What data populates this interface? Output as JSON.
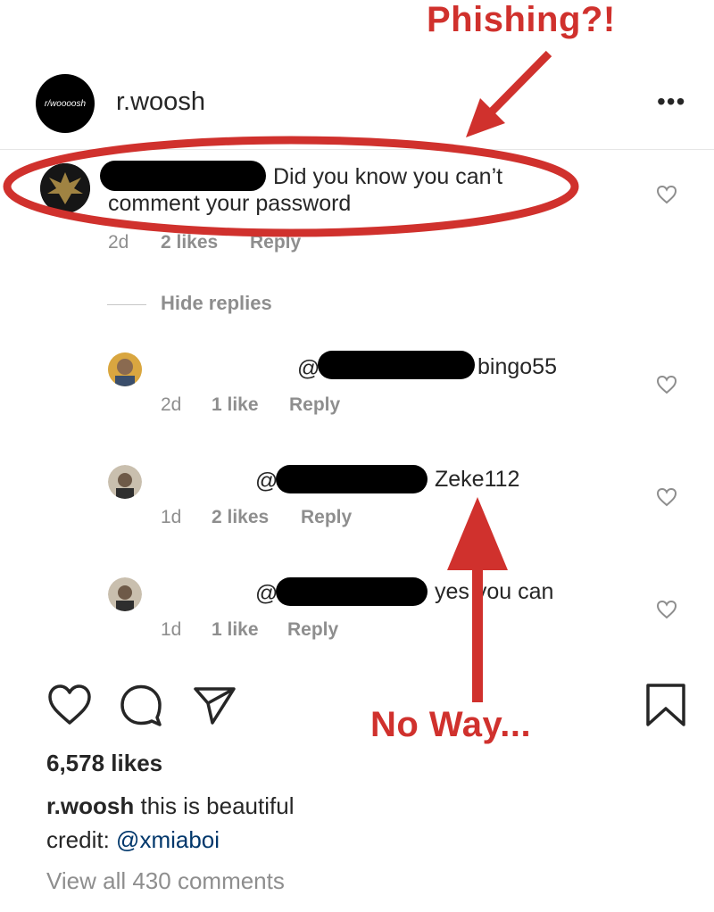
{
  "annotations": {
    "top_label": "Phishing?!",
    "bottom_label": "No Way...",
    "accent_color": "#d0312d"
  },
  "post": {
    "avatar_text": "r/woooosh",
    "username": "r.woosh",
    "more_icon": "more-options-icon"
  },
  "main_comment": {
    "text_line1": "Did you know you can’t",
    "text_line2": "comment your password",
    "time": "2d",
    "likes": "2 likes",
    "reply": "Reply"
  },
  "hide_replies": "Hide replies",
  "replies": [
    {
      "at": "@a",
      "text": "bingo55",
      "time": "2d",
      "likes": "1 like",
      "reply": "Reply"
    },
    {
      "at": "@a",
      "text": "Zeke112",
      "time": "1d",
      "likes": "2 likes",
      "reply": "Reply"
    },
    {
      "at": "@a",
      "text": "yes you can",
      "time": "1d",
      "likes": "1 like",
      "reply": "Reply"
    }
  ],
  "actions": {
    "like_icon": "heart-icon",
    "comment_icon": "comment-icon",
    "share_icon": "send-icon",
    "save_icon": "bookmark-icon"
  },
  "likes_count": "6,578 likes",
  "caption": {
    "username": "r.woosh",
    "text": "this is beautiful",
    "credit_label": "credit:",
    "credit_mention": "@xmiaboi"
  },
  "view_all_comments": "View all 430 comments"
}
